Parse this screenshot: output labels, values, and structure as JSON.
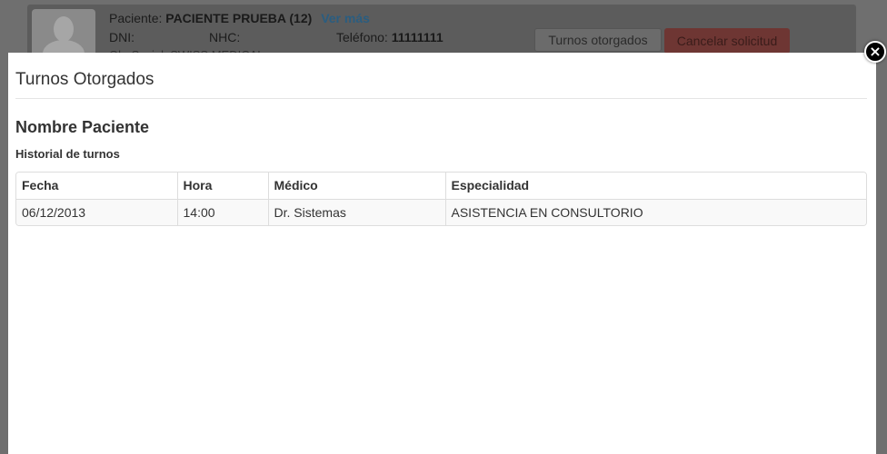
{
  "background": {
    "patient_label": "Paciente:",
    "patient_name": "PACIENTE PRUEBA (12)",
    "see_more": "Ver más",
    "dni_label": "DNI:",
    "nhc_label": "NHC:",
    "phone_label": "Teléfono:",
    "phone_value": "11111111",
    "obra_social": "Ob. Social: SWISS MEDICAL",
    "btn_turnos": "Turnos otorgados",
    "btn_cancel": "Cancelar solicitud"
  },
  "modal": {
    "title": "Turnos Otorgados",
    "patient_name": "Nombre Paciente",
    "history_title": "Historial de turnos",
    "close_glyph": "×",
    "table": {
      "headers": [
        "Fecha",
        "Hora",
        "Médico",
        "Especialidad"
      ],
      "rows": [
        [
          "06/12/2013",
          "14:00",
          "Dr. Sistemas",
          "ASISTENCIA EN CONSULTORIO"
        ]
      ]
    }
  },
  "colors": {
    "overlay": "#6f6f6f",
    "modal_bg": "#ffffff",
    "link": "#2a5d80",
    "danger": "#d9534f"
  }
}
